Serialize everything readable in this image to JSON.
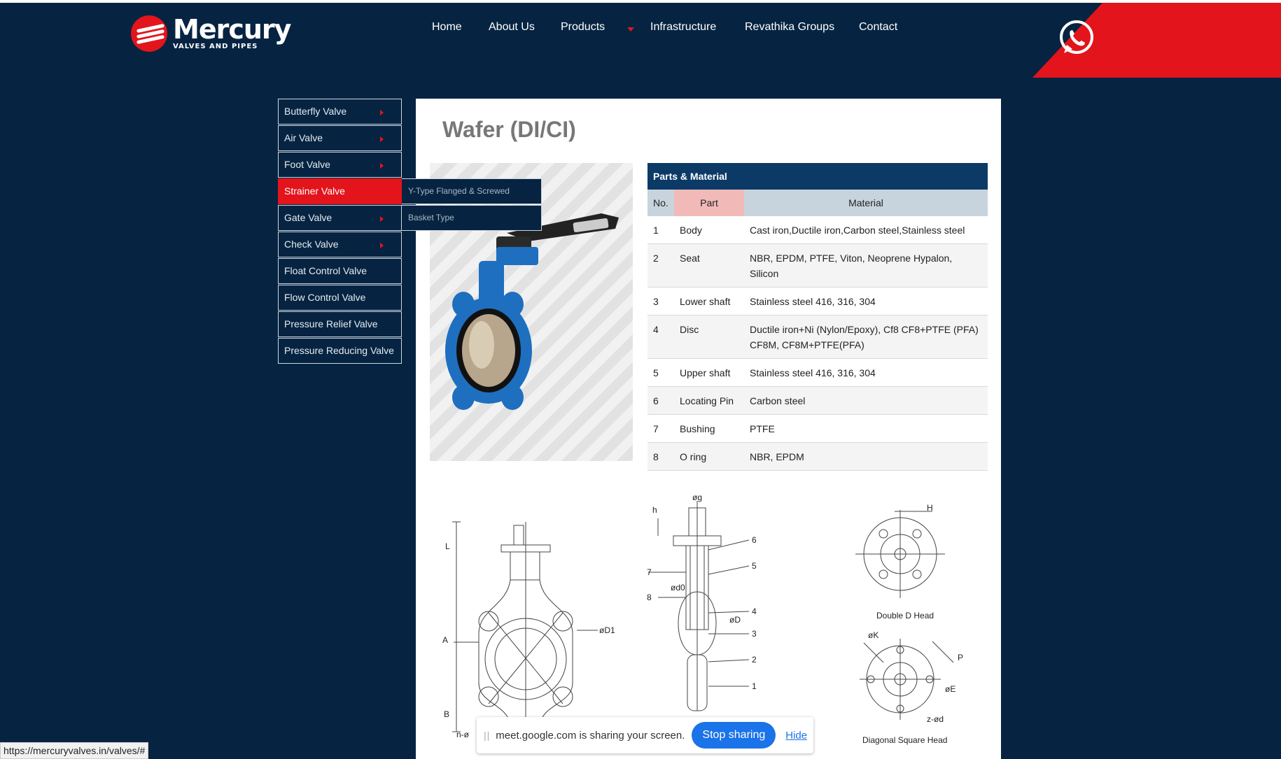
{
  "header": {
    "logo_name": "Mercury",
    "logo_sub": "VALVES AND PIPES",
    "nav": [
      "Home",
      "About Us",
      "Products",
      "Infrastructure",
      "Revathika Groups",
      "Contact"
    ]
  },
  "sidemenu": {
    "items": [
      {
        "label": "Butterfly Valve",
        "has_sub": true
      },
      {
        "label": "Air Valve",
        "has_sub": true
      },
      {
        "label": "Foot Valve",
        "has_sub": true
      },
      {
        "label": "Strainer Valve",
        "has_sub": false,
        "active": true
      },
      {
        "label": "Gate Valve",
        "has_sub": true
      },
      {
        "label": "Check Valve",
        "has_sub": true
      },
      {
        "label": "Float Control Valve",
        "has_sub": false
      },
      {
        "label": "Flow Control Valve",
        "has_sub": false
      },
      {
        "label": "Pressure Relief Valve",
        "has_sub": false
      },
      {
        "label": "Pressure Reducing Valve",
        "has_sub": false
      }
    ],
    "submenu": [
      "Y-Type Flanged & Screwed",
      "Basket Type"
    ]
  },
  "content": {
    "title": "Wafer (DI/CI)",
    "parts_table": {
      "heading": "Parts & Material",
      "columns": [
        "No.",
        "Part",
        "Material"
      ],
      "rows": [
        [
          "1",
          "Body",
          "Cast iron,Ductile iron,Carbon steel,Stainless steel"
        ],
        [
          "2",
          "Seat",
          "NBR, EPDM, PTFE, Viton, Neoprene Hypalon, Silicon"
        ],
        [
          "3",
          "Lower shaft",
          "Stainless steel 416, 316, 304"
        ],
        [
          "4",
          "Disc",
          "Ductile iron+Ni (Nylon/Epoxy), Cf8 CF8+PTFE (PFA) CF8M, CF8M+PTFE(PFA)"
        ],
        [
          "5",
          "Upper shaft",
          "Stainless steel 416, 316, 304"
        ],
        [
          "6",
          "Locating Pin",
          "Carbon steel"
        ],
        [
          "7",
          "Bushing",
          "PTFE"
        ],
        [
          "8",
          "O ring",
          "NBR, EPDM"
        ]
      ]
    },
    "drawings": {
      "front_labels": {
        "L": "L",
        "A": "A",
        "B": "B",
        "D1": "øD1",
        "n": "n-ø"
      },
      "section_labels": {
        "g": "øg",
        "h": "h",
        "d0": "ød0",
        "D": "øD",
        "n7": "7",
        "n8": "8",
        "n6": "6",
        "n5": "5",
        "n4": "4",
        "n3": "3",
        "n2": "2",
        "n1": "1"
      },
      "head1_caption": "Double D Head",
      "head1_label": "H",
      "head2_caption": "Diagonal Square Head",
      "head2_labels": {
        "K": "øK",
        "P": "P",
        "E": "øE",
        "z": "z-ød"
      }
    }
  },
  "overlay": {
    "status_url": "https://mercuryvalves.in/valves/#",
    "share_text": "meet.google.com is sharing your screen.",
    "stop_label": "Stop sharing",
    "hide_label": "Hide"
  },
  "colors": {
    "bg": "#062442",
    "accent": "#e3141b",
    "table_head": "#0b3a66"
  }
}
